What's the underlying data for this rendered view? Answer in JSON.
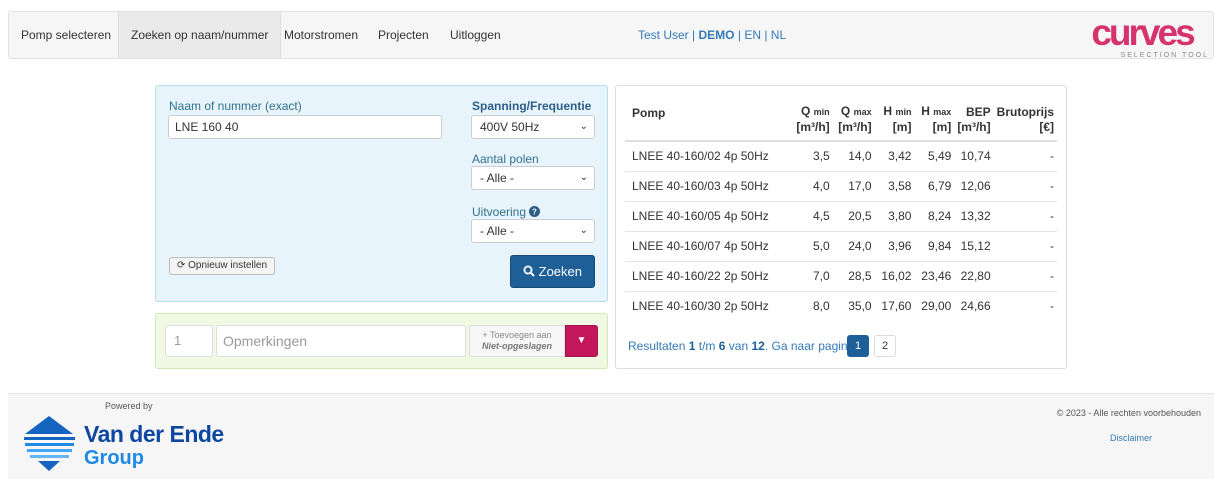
{
  "nav": {
    "items": [
      {
        "label": "Pomp selecteren"
      },
      {
        "label": "Zoeken op naam/nummer"
      },
      {
        "label": "Motorstromen"
      },
      {
        "label": "Projecten"
      },
      {
        "label": "Uitloggen"
      }
    ],
    "user": "Test User",
    "sep1": "|",
    "demo": "DEMO",
    "sep2": "|",
    "lang_en": "EN",
    "sep3": "|",
    "lang_nl": "NL"
  },
  "logo": {
    "text": "curves",
    "subtitle": "SELECTION TOOL",
    "color": "#d6336c"
  },
  "search": {
    "name_label": "Naam of nummer (exact)",
    "name_value": "LNE 160 40",
    "voltage_label": "Spanning/Frequentie",
    "voltage_value": "400V 50Hz",
    "poles_label": "Aantal polen",
    "poles_value": "- Alle -",
    "execution_label": "Uitvoering",
    "execution_value": "- Alle -",
    "reset_label": "Opnieuw instellen",
    "search_label": "Zoeken"
  },
  "notes": {
    "qty_placeholder": "1",
    "remarks_placeholder": "Opmerkingen",
    "add_line1": "Toevoegen aan",
    "add_line2": "Niet-opgeslagen"
  },
  "results": {
    "headers": {
      "pomp": "Pomp",
      "qmin": "Q",
      "qmin_sub": "min",
      "qmin_unit": "[m³/h]",
      "qmax": "Q",
      "qmax_sub": "max",
      "qmax_unit": "[m³/h]",
      "hmin": "H",
      "hmin_sub": "min",
      "hmin_unit": "[m]",
      "hmax": "H",
      "hmax_sub": "max",
      "hmax_unit": "[m]",
      "bep": "BEP",
      "bep_unit": "[m³/h]",
      "price": "Brutoprijs",
      "price_unit": "[€]"
    },
    "rows": [
      {
        "name": "LNEE 40-160/02 4p 50Hz",
        "qmin": "3,5",
        "qmax": "14,0",
        "hmin": "3,42",
        "hmax": "5,49",
        "bep": "10,74",
        "price": "-"
      },
      {
        "name": "LNEE 40-160/03 4p 50Hz",
        "qmin": "4,0",
        "qmax": "17,0",
        "hmin": "3,58",
        "hmax": "6,79",
        "bep": "12,06",
        "price": "-"
      },
      {
        "name": "LNEE 40-160/05 4p 50Hz",
        "qmin": "4,5",
        "qmax": "20,5",
        "hmin": "3,80",
        "hmax": "8,24",
        "bep": "13,32",
        "price": "-"
      },
      {
        "name": "LNEE 40-160/07 4p 50Hz",
        "qmin": "5,0",
        "qmax": "24,0",
        "hmin": "3,96",
        "hmax": "9,84",
        "bep": "15,12",
        "price": "-"
      },
      {
        "name": "LNEE 40-160/22 2p 50Hz",
        "qmin": "7,0",
        "qmax": "28,5",
        "hmin": "16,02",
        "hmax": "23,46",
        "bep": "22,80",
        "price": "-"
      },
      {
        "name": "LNEE 40-160/30 2p 50Hz",
        "qmin": "8,0",
        "qmax": "35,0",
        "hmin": "17,60",
        "hmax": "29,00",
        "bep": "24,66",
        "price": "-"
      }
    ],
    "pager": {
      "prefix": "Resultaten",
      "from": "1",
      "to_word": "t/m",
      "to": "6",
      "of_word": "van",
      "total": "12",
      "goto": ". Ga naar pagina:",
      "pages": [
        "1",
        "2"
      ]
    }
  },
  "footer": {
    "powered_by": "Powered by",
    "company_line1": "Van der Ende",
    "company_line2": "Group",
    "copyright": "© 2023 - Alle rechten voorbehouden",
    "disclaimer": "Disclaimer"
  }
}
